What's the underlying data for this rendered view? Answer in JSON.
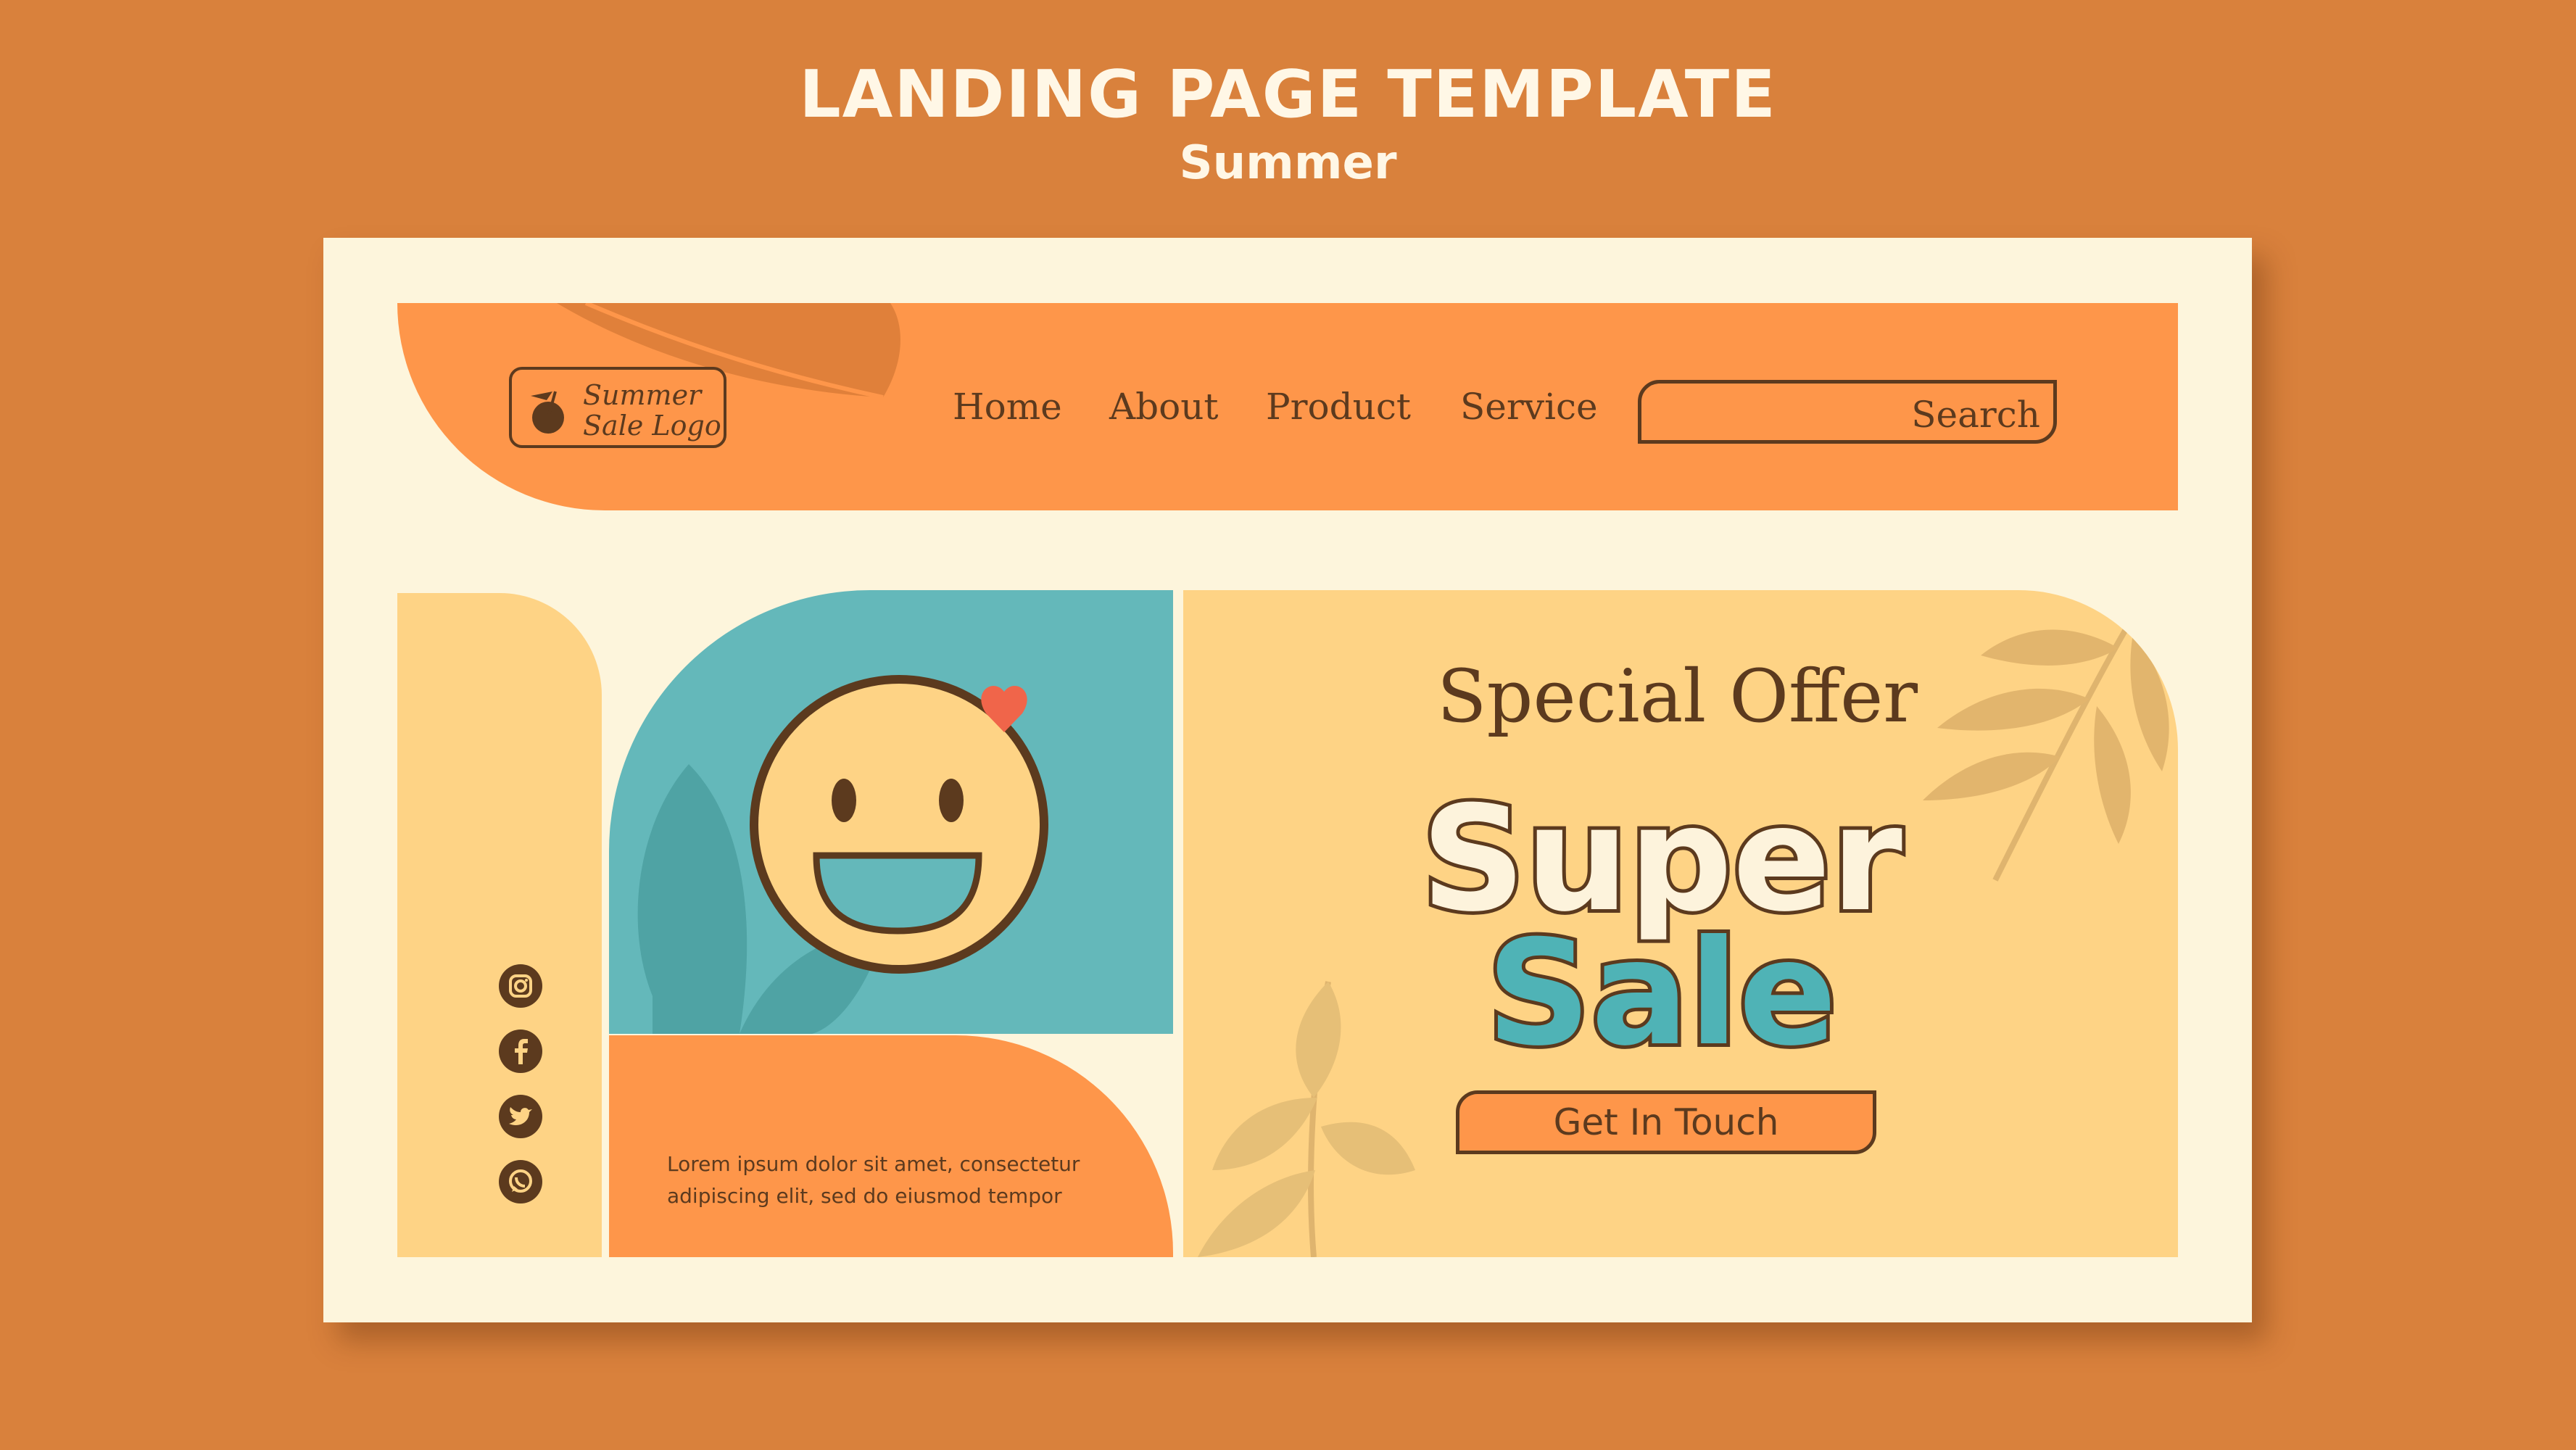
{
  "page": {
    "title": "LANDING PAGE TEMPLATE",
    "subtitle": "Summer"
  },
  "logo": {
    "line1": "Summer",
    "line2": "Sale Logo"
  },
  "nav": {
    "items": [
      "Home",
      "About",
      "Product",
      "Service"
    ]
  },
  "search": {
    "label": "Search"
  },
  "social": {
    "icons": [
      "instagram-icon",
      "facebook-icon",
      "twitter-icon",
      "whatsapp-icon"
    ]
  },
  "body_text": {
    "line1": "Lorem ipsum dolor sit amet, consectetur",
    "line2": "adipiscing elit, sed do eiusmod tempor"
  },
  "offer": {
    "special": "Special Offer",
    "word1": "Super",
    "word2": "Sale",
    "cta": "Get In Touch"
  },
  "colors": {
    "background": "#d9813c",
    "card": "#fdf5dc",
    "orange": "#fe964a",
    "yellow": "#fed385",
    "teal": "#64b8ba",
    "brown": "#5c3a1e"
  }
}
